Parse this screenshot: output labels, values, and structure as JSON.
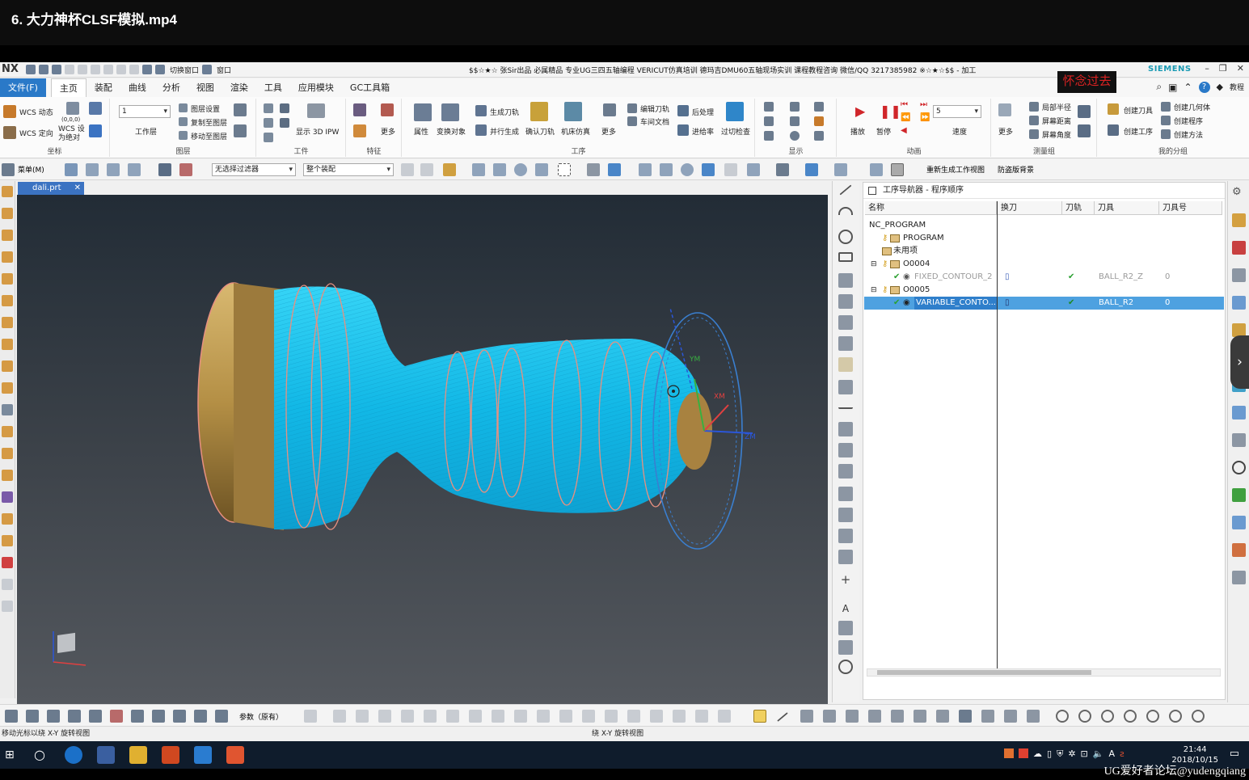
{
  "video": {
    "title": "6. 大力神杯CLSF模拟.mp4"
  },
  "app": {
    "logo": "NX",
    "window_title": "$$☆★☆ 张Sir出品 必属精品 专业UG三四五轴编程 VERICUT仿真培训 德玛吉DMU60五轴现场实训 课程教程咨询 微信/QQ 3217385982 ※☆★☆$$ - 加工",
    "brand": "SIEMENS",
    "switch_window": "切换窗口",
    "window_menu": "窗口",
    "watermark": "怀念过去",
    "tutorial": "教程"
  },
  "menu": {
    "file": "文件(F)",
    "items": [
      "主页",
      "装配",
      "曲线",
      "分析",
      "视图",
      "渲染",
      "工具",
      "应用模块",
      "GC工具箱"
    ],
    "active": "主页"
  },
  "ribbon": {
    "wcs_dynamic": "WCS 动态",
    "wcs_origin": "WCS 定向",
    "wcs_set": "WCS 设为绝对",
    "coords": "(0,0,0)",
    "group_coords": "坐标",
    "layer_value": "1",
    "work_layer": "工作层",
    "layer_settings": "图层设置",
    "copy_to_layer": "复制至图层",
    "move_to_layer": "移动至图层",
    "group_layers": "图层",
    "show_3d_ipw": "显示 3D IPW",
    "group_workpiece": "工件",
    "more": "更多",
    "group_feature": "特征",
    "properties": "属性",
    "transform": "变换对象",
    "gen_toolpath": "生成刀轨",
    "parallel_gen": "并行生成",
    "verify_toolpath": "确认刀轨",
    "machine_sim": "机床仿真",
    "edit_toolpath": "编辑刀轨",
    "shop_doc": "车间文档",
    "post_process": "后处理",
    "feeds_speeds": "进给率",
    "gouge_check": "过切检查",
    "group_operation": "工序",
    "group_display": "显示",
    "play": "播放",
    "pause": "暂停",
    "speed_value": "5",
    "speed": "速度",
    "group_animation": "动画",
    "local_radius": "局部半径",
    "screen_distance": "屏幕距离",
    "screen_angle": "屏幕角度",
    "group_measure": "测量组",
    "create_tool": "创建刀具",
    "create_geometry": "创建几何体",
    "create_program": "创建程序",
    "create_operation": "创建工序",
    "create_method": "创建方法",
    "group_mygroup": "我的分组"
  },
  "toolbar2": {
    "menu": "菜单(M)",
    "filter": "无选择过滤器",
    "scope": "整个装配",
    "regen_view": "重新生成工作视图",
    "antialias": "防盗版背景"
  },
  "document": {
    "tab": "dali.prt"
  },
  "navigator": {
    "title": "工序导航器 - 程序顺序",
    "columns": [
      "名称",
      "换刀",
      "刀轨",
      "刀具",
      "刀具号"
    ],
    "rows": [
      {
        "name": "NC_PROGRAM",
        "level": 0,
        "tool_change": "",
        "path": "",
        "tool": "",
        "tool_no": ""
      },
      {
        "name": "PROGRAM",
        "level": 1,
        "tool_change": "",
        "path": "",
        "tool": "",
        "tool_no": ""
      },
      {
        "name": "未用项",
        "level": 1,
        "tool_change": "",
        "path": "",
        "tool": "",
        "tool_no": ""
      },
      {
        "name": "O0004",
        "level": 1,
        "tool_change": "",
        "path": "",
        "tool": "",
        "tool_no": ""
      },
      {
        "name": "FIXED_CONTOUR_2",
        "level": 2,
        "tool_change": "▯",
        "path": "✔",
        "tool": "BALL_R2_Z",
        "tool_no": "0",
        "faded": true
      },
      {
        "name": "O0005",
        "level": 1,
        "tool_change": "",
        "path": "",
        "tool": "",
        "tool_no": ""
      },
      {
        "name": "VARIABLE_CONTO...",
        "level": 2,
        "tool_change": "▯",
        "path": "✔",
        "tool": "BALL_R2",
        "tool_no": "0",
        "selected": true
      }
    ]
  },
  "bottom_toolbar": {
    "ref": "参数（原有）"
  },
  "status": {
    "left": "移动光标以绕 X-Y 旋转视图",
    "center": "绕 X-Y 旋转视图"
  },
  "taskbar": {
    "time": "21:44",
    "date": "2018/10/15",
    "ime": "A"
  },
  "forum_watermark": "UG爱好者论坛@yudengqiang",
  "viewport": {
    "axis_labels": [
      "YM",
      "XM",
      "ZM"
    ]
  },
  "colors": {
    "toolpath": "#18c7f0",
    "stock": "#c8a050",
    "accent": "#2a79c8",
    "selection": "#4ea1e0"
  }
}
